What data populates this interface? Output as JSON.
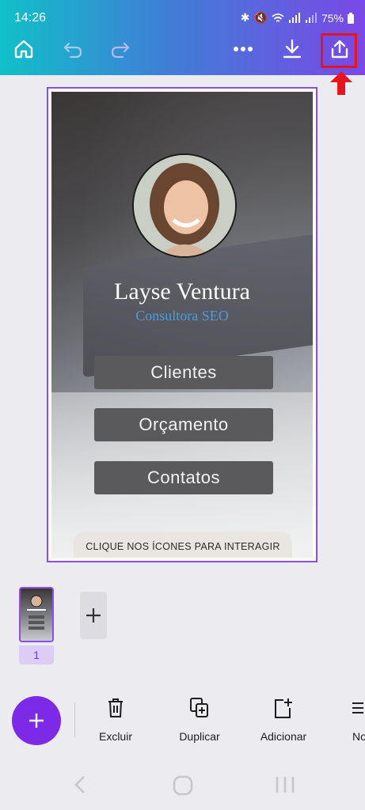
{
  "status_bar": {
    "time": "14:26",
    "battery": "75%"
  },
  "toolbar": {
    "icons": [
      "home-icon",
      "undo-icon",
      "redo-icon",
      "more-icon",
      "download-icon",
      "share-icon"
    ]
  },
  "design": {
    "name": "Layse Ventura",
    "role": "Consultora SEO",
    "buttons": [
      "Clientes",
      "Orçamento",
      "Contatos"
    ],
    "hint": "CLIQUE NOS ÍCONES PARA INTERAGIR"
  },
  "pages": {
    "current_page": "1"
  },
  "bottom_tools": {
    "delete": "Excluir",
    "duplicate": "Duplicar",
    "add": "Adicionar",
    "notes": "No"
  },
  "colors": {
    "accent": "#7d2ae8",
    "highlight": "#e5161f"
  }
}
